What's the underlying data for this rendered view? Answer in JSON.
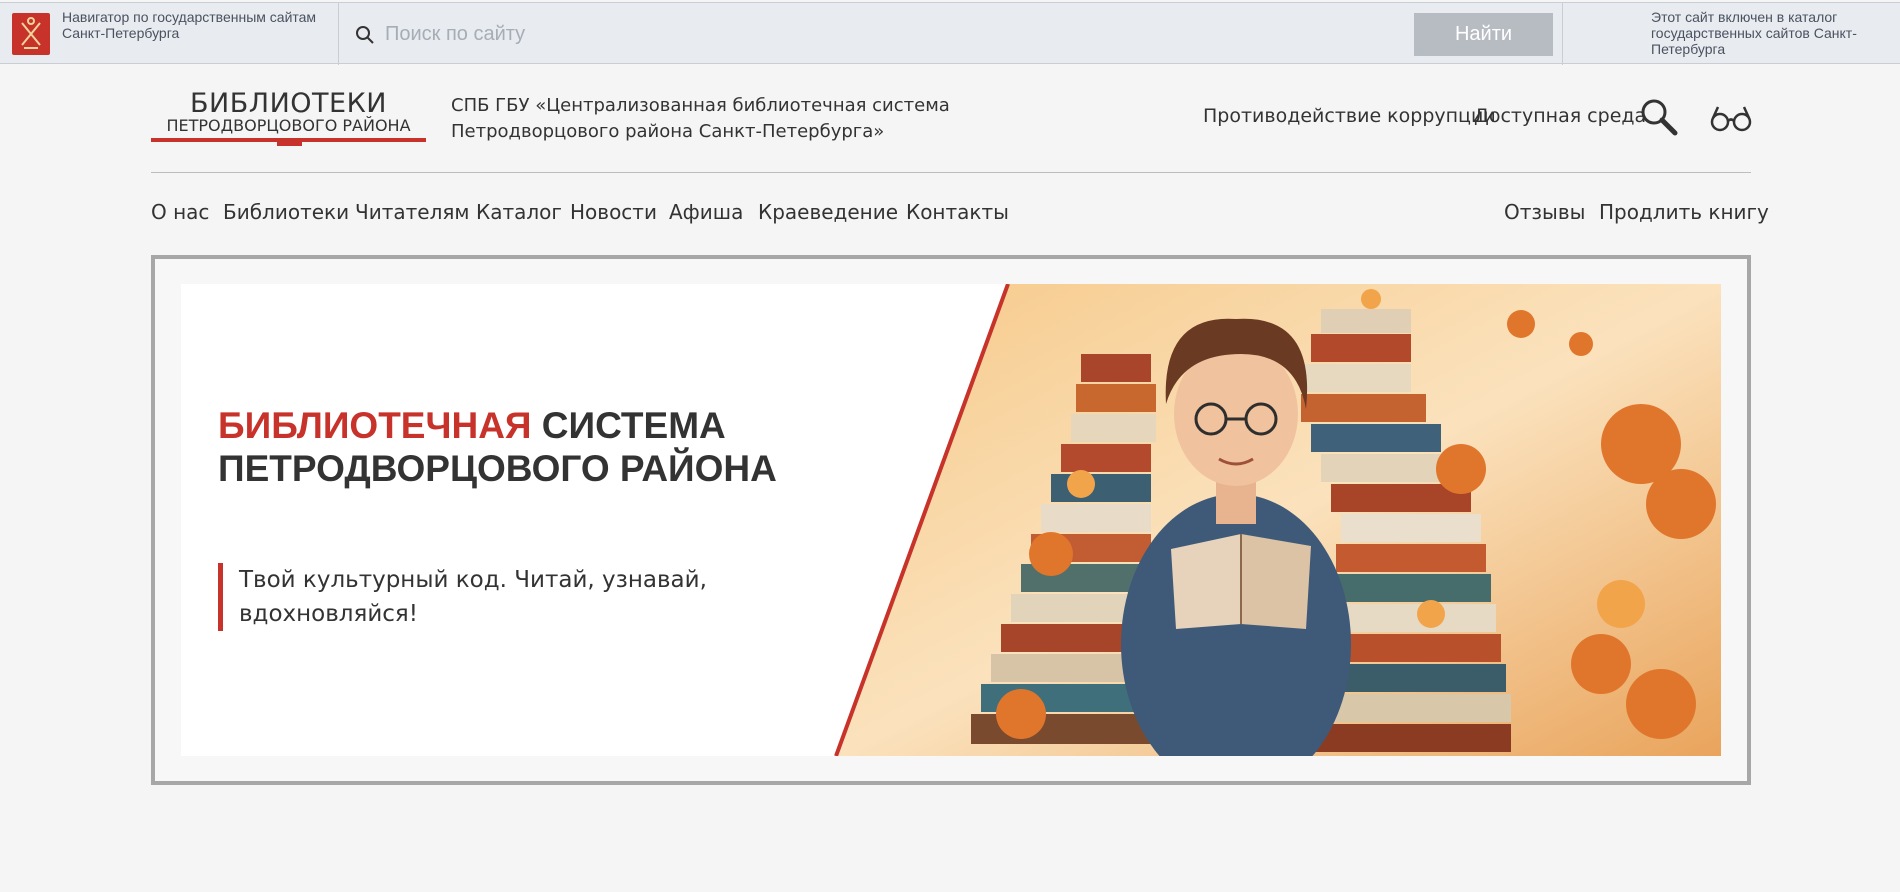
{
  "gov_bar": {
    "navigator_text": "Навигатор по государственным сайтам Санкт-Петербурга",
    "search": {
      "placeholder": "Поиск по сайту",
      "value": "",
      "button_label": "Найти"
    },
    "catalog_note": "Этот сайт включен в каталог государственных сайтов Санкт-Петербурга"
  },
  "header": {
    "logo": {
      "line1": "БИБЛИОТЕКИ",
      "line2": "ПЕТРОДВОРЦОВОГО РАЙОНА"
    },
    "org_name": "СПБ ГБУ «Централизованная библиотечная система Петродворцового района Санкт-Петербурга»",
    "links": {
      "anticorruption": "Противодействие коррупции",
      "accessible": "Доступная среда"
    },
    "icons": {
      "search": "magnifier-icon",
      "accessibility": "glasses-icon"
    }
  },
  "nav": {
    "left": [
      "О нас",
      "Библиотеки",
      "Читателям",
      "Каталог",
      "Новости",
      "Афиша",
      "Краеведение",
      "Контакты"
    ],
    "right": [
      "Отзывы",
      "Продлить книгу"
    ]
  },
  "banner": {
    "title_accent": "БИБЛИОТЕЧНАЯ",
    "title_rest": "СИСТЕМА ПЕТРОДВОРЦОВОГО РАЙОНА",
    "subtitle": "Твой культурный код. Читай, узнавай, вдохновляйся!",
    "image": "illustration of a boy with glasses reading among stacks of books with autumn leaves"
  },
  "colors": {
    "accent": "#c7332a",
    "text": "#333333",
    "gov_bar_bg": "#e8ebef",
    "search_button": "#b7bcc3",
    "page_bg": "#f5f5f5"
  }
}
